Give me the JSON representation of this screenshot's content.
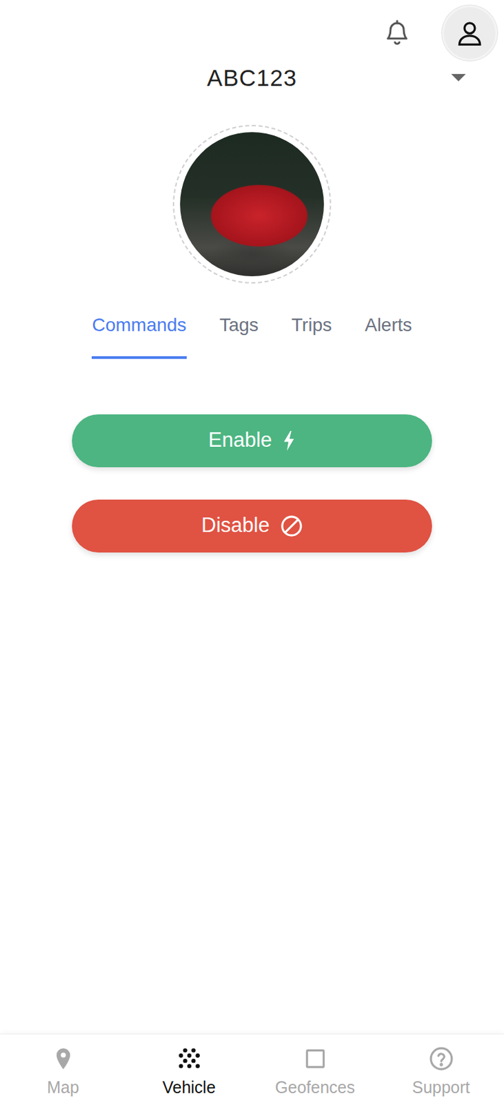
{
  "vehicle": {
    "plate": "ABC123"
  },
  "tabs": [
    {
      "label": "Commands",
      "selected": true
    },
    {
      "label": "Tags",
      "selected": false
    },
    {
      "label": "Trips",
      "selected": false
    },
    {
      "label": "Alerts",
      "selected": false
    }
  ],
  "commands": [
    {
      "label": "Enable",
      "kind": "enable",
      "color": "#4cb581"
    },
    {
      "label": "Disable",
      "kind": "disable",
      "color": "#e05242"
    }
  ],
  "bottom_nav": [
    {
      "label": "Map",
      "kind": "map",
      "selected": false
    },
    {
      "label": "Vehicle",
      "kind": "vehicle",
      "selected": true
    },
    {
      "label": "Geofences",
      "kind": "geofence",
      "selected": false
    },
    {
      "label": "Support",
      "kind": "support",
      "selected": false
    }
  ]
}
